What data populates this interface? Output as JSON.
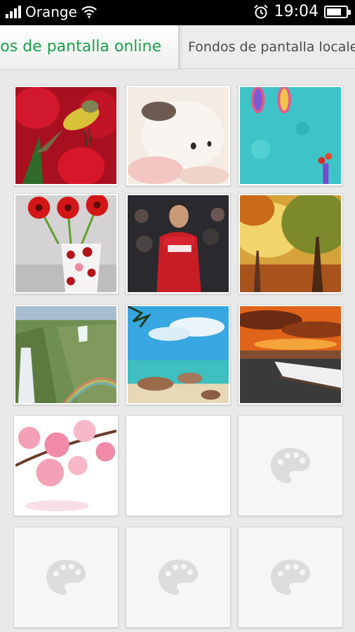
{
  "status_bar": {
    "carrier": "Orange",
    "time": "19:04",
    "icons": [
      "signal-icon",
      "wifi-icon",
      "alarm-icon",
      "battery-icon"
    ],
    "battery_level": 0.65
  },
  "tabs": [
    {
      "label": "Fondos de pantalla online",
      "active": true,
      "color": "#19a04b"
    },
    {
      "label": "Fondos de pantalla locales",
      "active": false
    }
  ],
  "wallpapers": [
    {
      "subject": "bird-on-red-tulips",
      "colors": [
        "#c0132b",
        "#e8d23a"
      ]
    },
    {
      "subject": "white-kitten",
      "colors": [
        "#f1e6da",
        "#d9bfae"
      ]
    },
    {
      "subject": "flip-flops-on-turquoise",
      "colors": [
        "#3ec4c8",
        "#2aaeb3"
      ]
    },
    {
      "subject": "red-gerberas-polka-vase",
      "colors": [
        "#d21c1c",
        "#f2f2f2"
      ]
    },
    {
      "subject": "football-player-red-jersey",
      "colors": [
        "#c81d25",
        "#1e1e1e"
      ]
    },
    {
      "subject": "autumn-forest-sunlight",
      "colors": [
        "#d98a1c",
        "#6d7b2a"
      ]
    },
    {
      "subject": "waterfall-rainbow",
      "colors": [
        "#6f8f52",
        "#a7b6c9"
      ]
    },
    {
      "subject": "tropical-beach",
      "colors": [
        "#38a6e0",
        "#3fbfc0"
      ]
    },
    {
      "subject": "boat-at-sunset",
      "colors": [
        "#e0631a",
        "#3a3a3a"
      ]
    },
    {
      "subject": "pink-cherry-blossoms",
      "colors": [
        "#f08aa6",
        "#ffffff"
      ]
    },
    {
      "subject": "blank",
      "colors": [
        "#ffffff",
        "#ffffff"
      ]
    },
    {
      "subject": "loading-placeholder",
      "icon": "palette-icon"
    },
    {
      "subject": "loading-placeholder",
      "icon": "palette-icon"
    },
    {
      "subject": "loading-placeholder",
      "icon": "palette-icon"
    },
    {
      "subject": "loading-placeholder",
      "icon": "palette-icon"
    }
  ]
}
